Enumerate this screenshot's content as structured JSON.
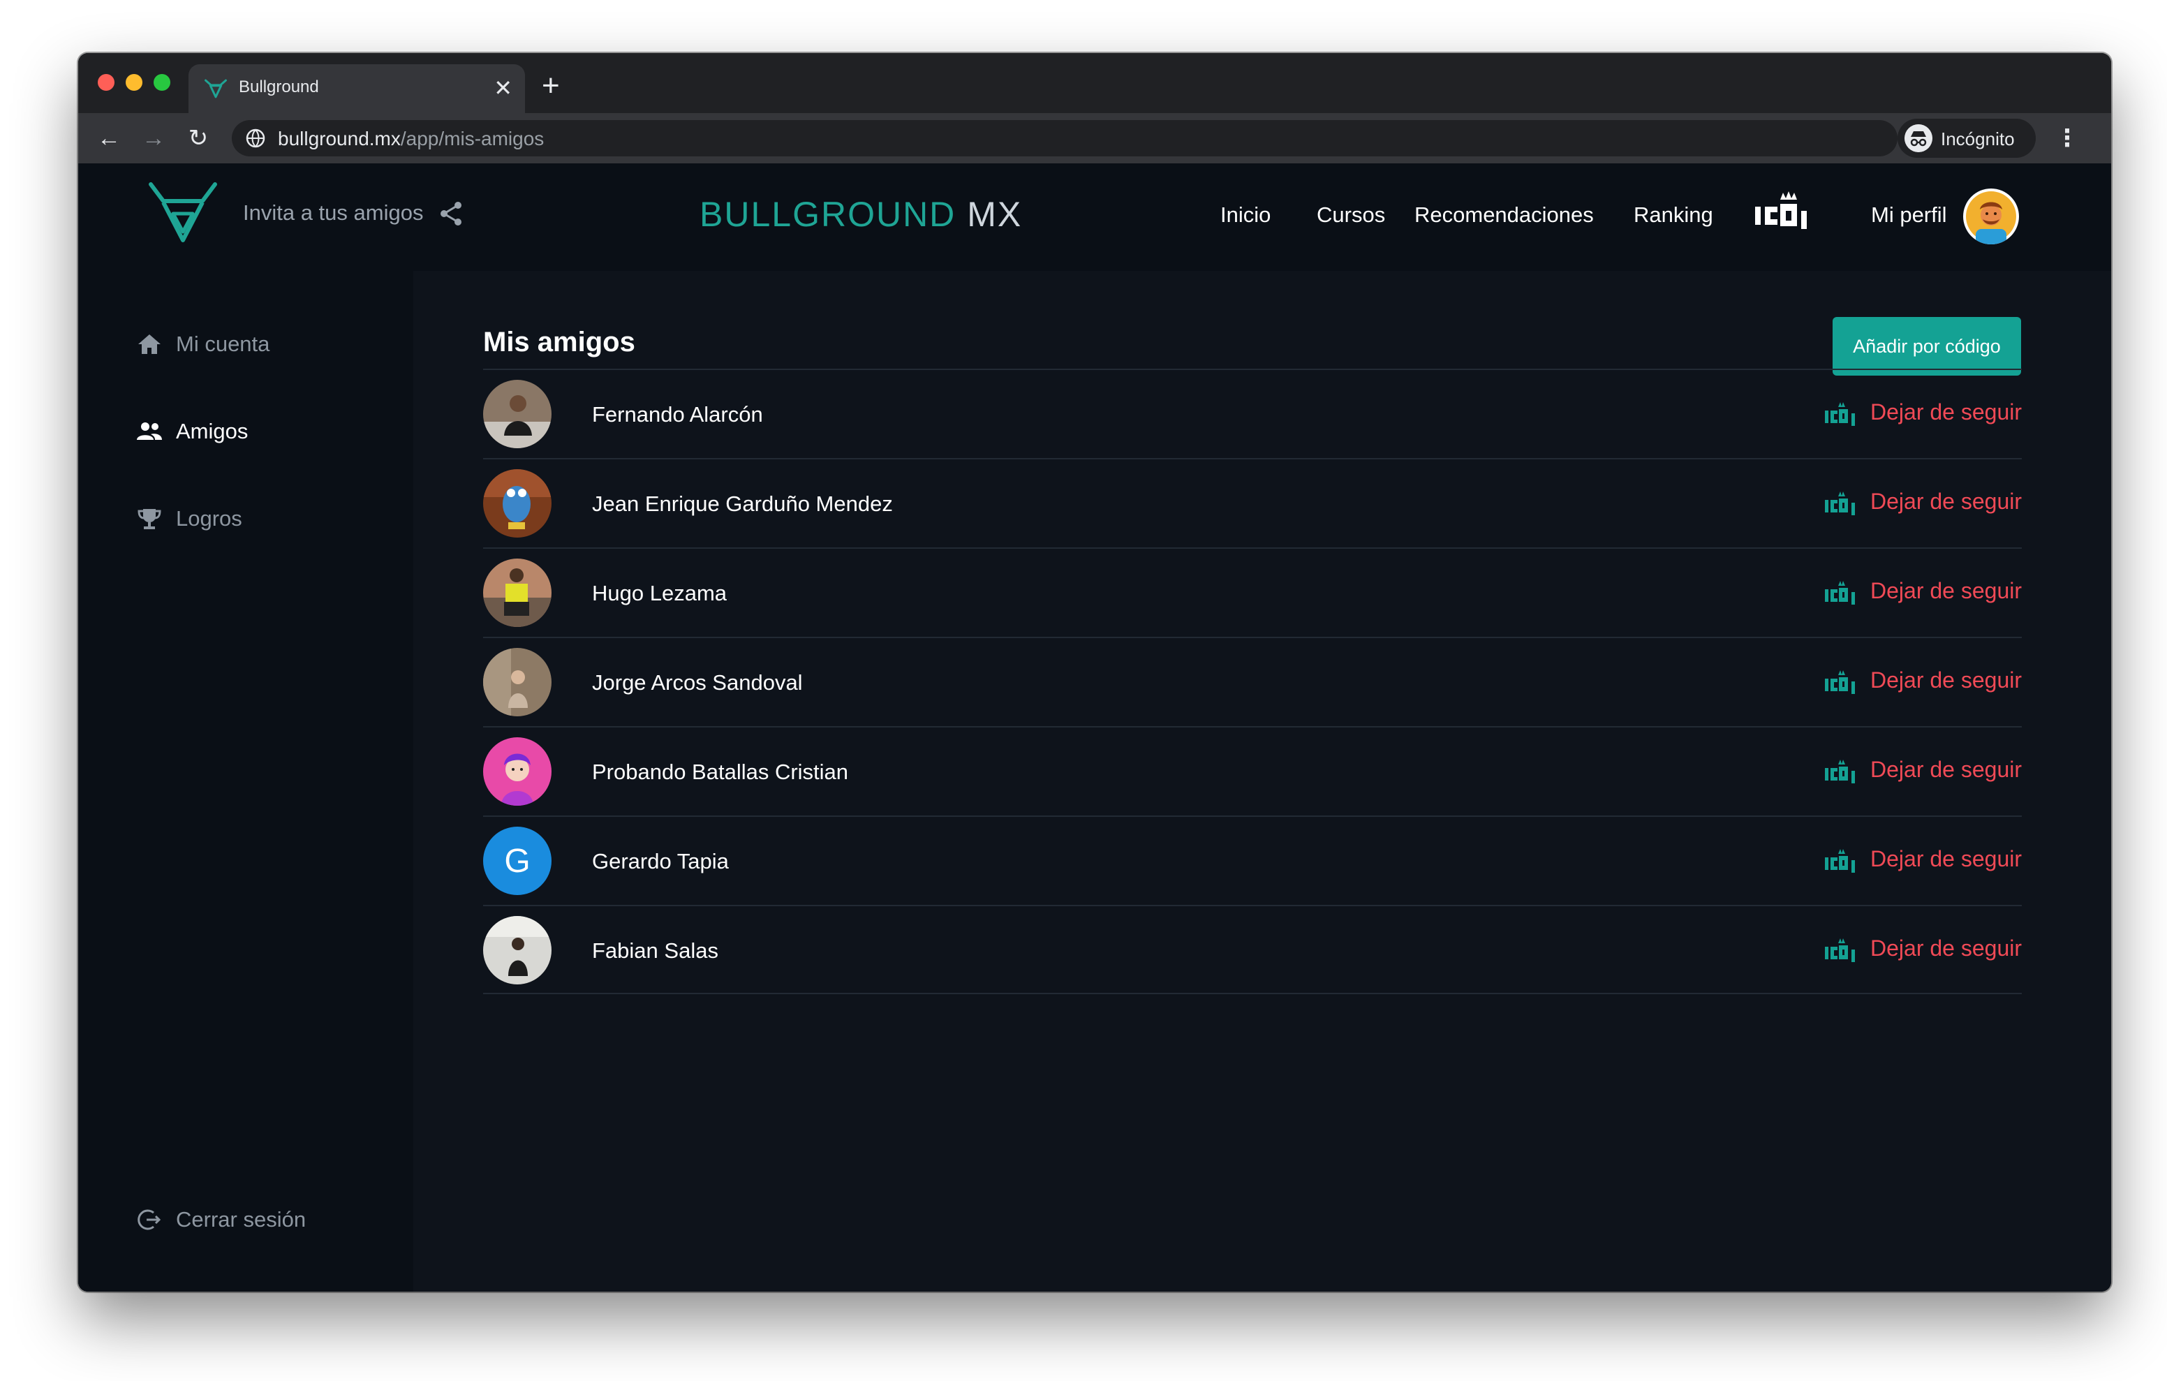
{
  "browser": {
    "tab_title": "Bullground",
    "url_host": "bullground.mx",
    "url_path": "/app/mis-amigos",
    "incognito_label": "Incógnito",
    "tab_close_glyph": "✕",
    "new_tab_glyph": "+",
    "back_glyph": "←",
    "forward_glyph": "→",
    "reload_glyph": "↻",
    "menu_glyph": "⋮"
  },
  "header": {
    "invite_label": "Invita a tus amigos",
    "brand_primary": "BULLGROUND",
    "brand_secondary": "MX",
    "nav": [
      "Inicio",
      "Cursos",
      "Recomendaciones",
      "Ranking",
      "Mi perfil"
    ]
  },
  "sidebar": {
    "items": [
      {
        "label": "Mi cuenta",
        "icon": "home-icon",
        "active": false
      },
      {
        "label": "Amigos",
        "icon": "people-icon",
        "active": true
      },
      {
        "label": "Logros",
        "icon": "trophy-icon",
        "active": false
      }
    ],
    "logout_label": "Cerrar sesión"
  },
  "main": {
    "title": "Mis amigos",
    "add_button_label": "Añadir por código",
    "unfollow_label": "Dejar de seguir",
    "friends": [
      {
        "name": "Fernando Alarcón",
        "avatar": "photo"
      },
      {
        "name": "Jean Enrique Garduño Mendez",
        "avatar": "photo"
      },
      {
        "name": "Hugo Lezama",
        "avatar": "photo"
      },
      {
        "name": "Jorge Arcos Sandoval",
        "avatar": "photo"
      },
      {
        "name": "Probando Batallas Cristian",
        "avatar": "cartoon"
      },
      {
        "name": "Gerardo Tapia",
        "avatar": "initial",
        "initial": "G"
      },
      {
        "name": "Fabian Salas",
        "avatar": "photo"
      }
    ]
  },
  "colors": {
    "accent": "#14a294",
    "danger": "#f04a56",
    "background": "#0e131b",
    "panel": "#0a0f16"
  }
}
